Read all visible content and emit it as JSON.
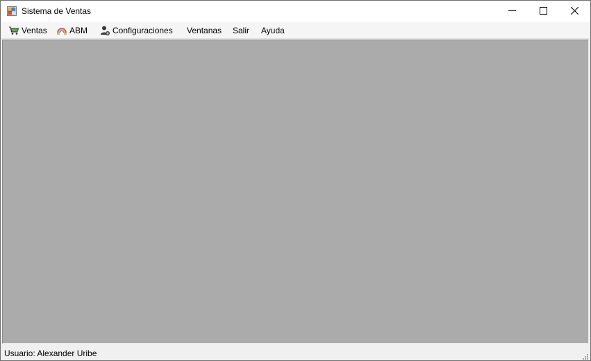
{
  "window": {
    "title": "Sistema de Ventas",
    "app_icon": "windows-form-icon",
    "controls": [
      "minimize",
      "maximize",
      "close"
    ]
  },
  "menubar": {
    "items": [
      {
        "label": "Ventas",
        "icon": "shopping-cart-icon"
      },
      {
        "label": "ABM",
        "icon": "abm-icon"
      },
      {
        "label": "Configuraciones",
        "icon": "user-settings-icon"
      },
      {
        "label": "Ventanas"
      },
      {
        "label": "Salir"
      },
      {
        "label": "Ayuda"
      }
    ]
  },
  "statusbar": {
    "user_text": "Usuario: Alexander Uribe"
  },
  "colors": {
    "mdi_background": "#ababab",
    "menubar_background": "#f5f5f5",
    "statusbar_background": "#f0f0f0"
  }
}
